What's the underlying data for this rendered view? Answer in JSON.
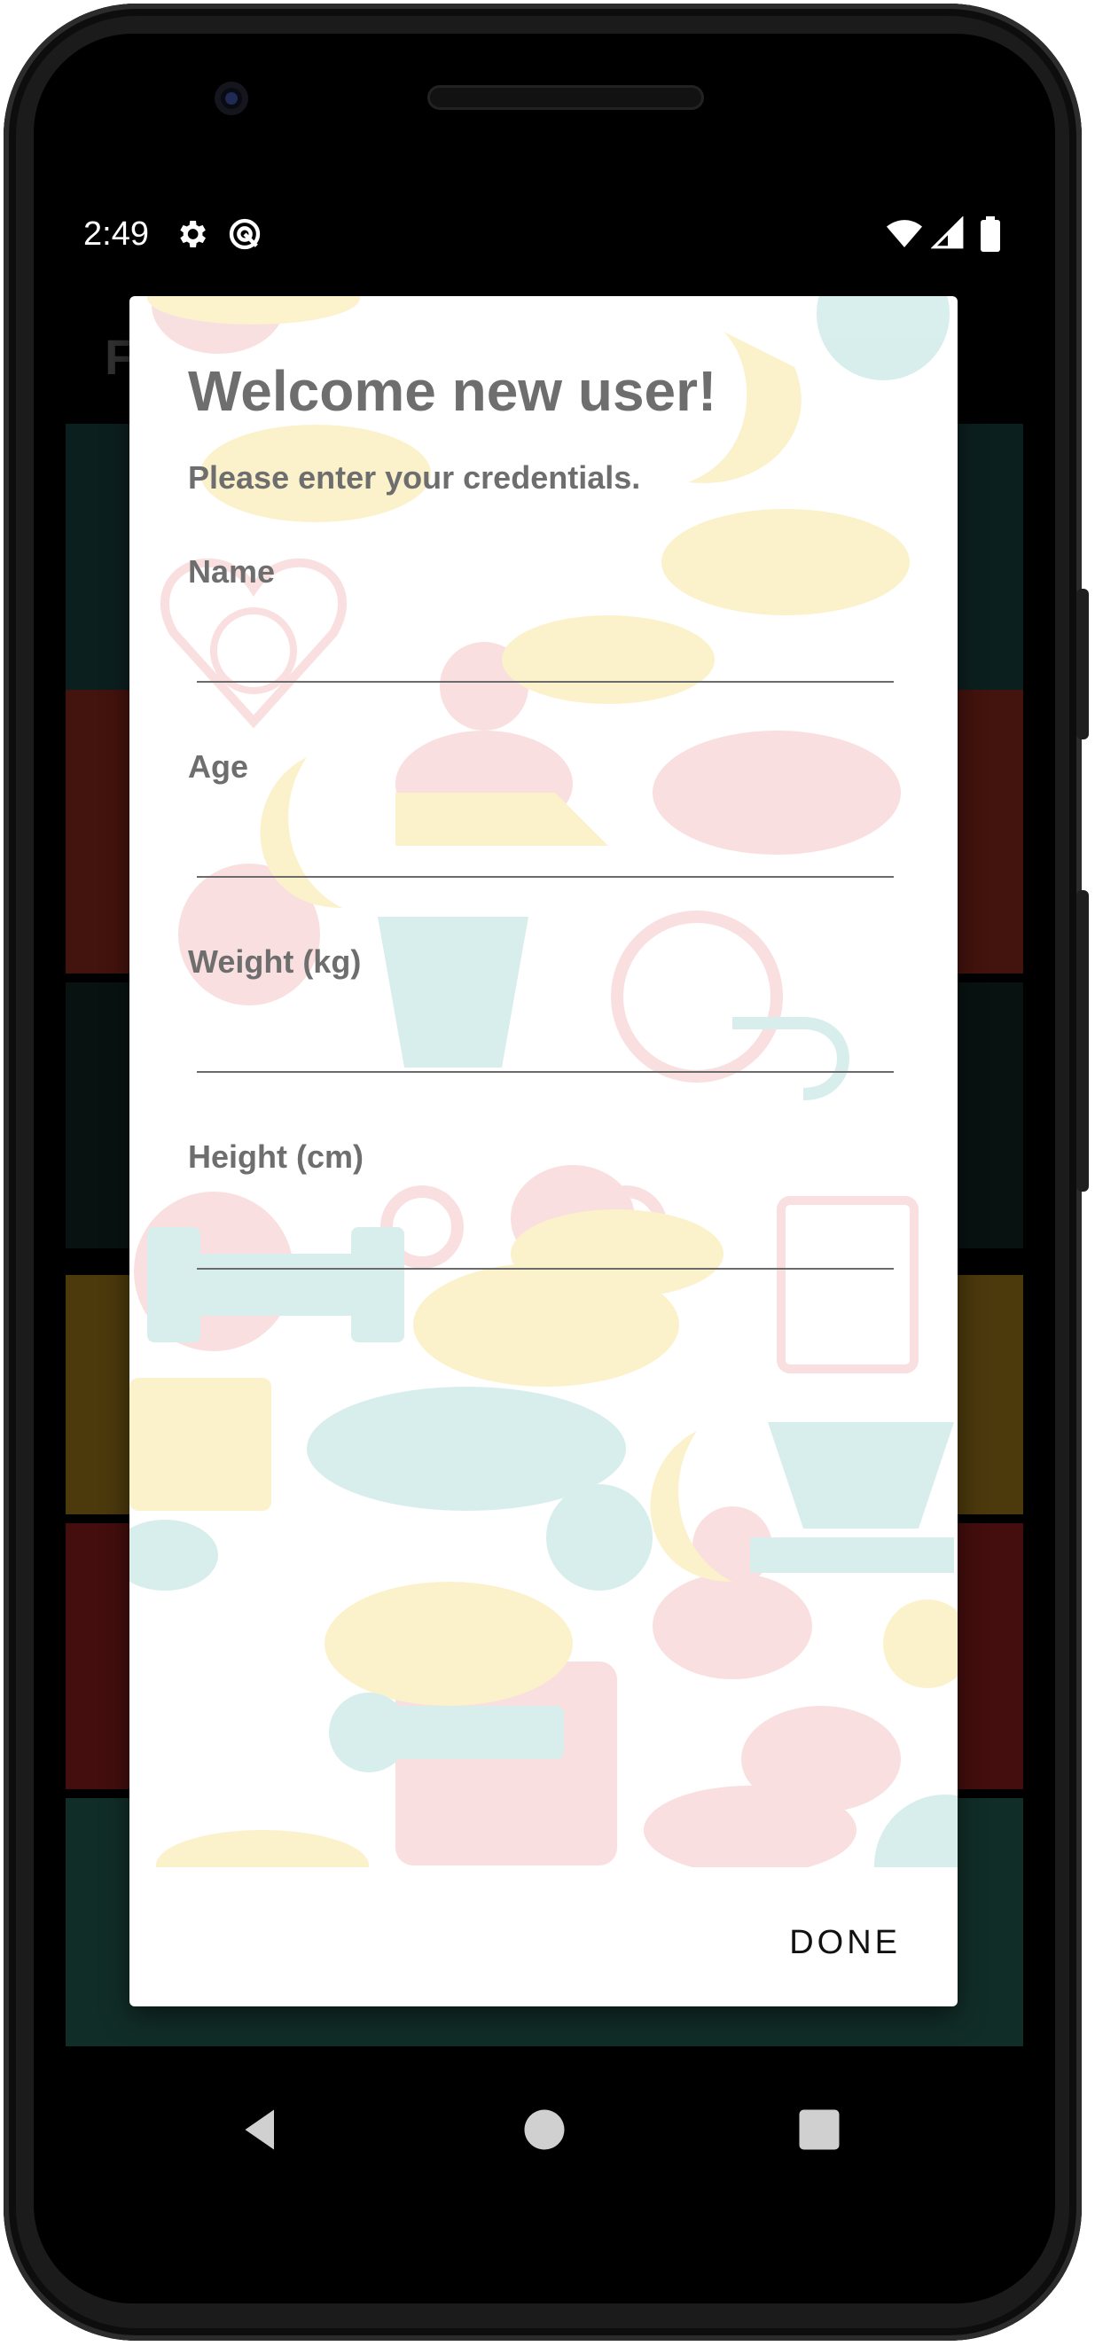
{
  "status_bar": {
    "time": "2:49",
    "icons": [
      "settings-icon",
      "sync-icon",
      "wifi-icon",
      "signal-icon",
      "battery-icon"
    ]
  },
  "background_app": {
    "toolbar_fragment": "F",
    "tile_colors": [
      "#1d8a74",
      "#9e1b1b",
      "#cf8a12",
      "#1f2a33",
      "#a21e1e",
      "#2a9a7f"
    ]
  },
  "dialog": {
    "title": "Welcome new user!",
    "subtitle": "Please enter your credentials.",
    "fields": [
      {
        "label": "Name",
        "value": ""
      },
      {
        "label": "Age",
        "value": ""
      },
      {
        "label": "Weight (kg)",
        "value": ""
      },
      {
        "label": "Height (cm)",
        "value": ""
      }
    ],
    "done_label": "DONE",
    "background_illustration": "health-and-fitness-icons-pattern"
  },
  "nav_bar": {
    "buttons": [
      "back-icon",
      "home-icon",
      "recents-icon"
    ]
  },
  "colors": {
    "dialog_text": "#6e6e6e",
    "underline": "#6b6b6b",
    "button_text": "#111111"
  }
}
